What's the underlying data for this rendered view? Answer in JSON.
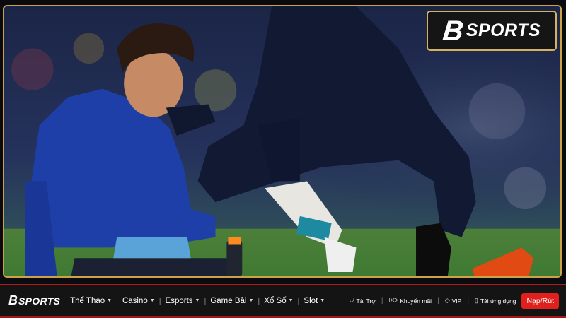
{
  "brand": {
    "mark": "B",
    "name": "SPORTS"
  },
  "nav": {
    "items": [
      {
        "label": "Thể Thao"
      },
      {
        "label": "Casino"
      },
      {
        "label": "Esports"
      },
      {
        "label": "Game Bài"
      },
      {
        "label": "Xổ Số"
      },
      {
        "label": "Slot"
      }
    ],
    "utilities": [
      {
        "label": "Tài Trợ",
        "icon": "shield-icon"
      },
      {
        "label": "Khuyến mãi",
        "icon": "tag-icon"
      },
      {
        "label": "VIP",
        "icon": "diamond-icon"
      },
      {
        "label": "Tải ứng dụng",
        "icon": "phone-icon"
      }
    ],
    "deposit_label": "Nạp/Rút"
  },
  "colors": {
    "accent": "#e0201d",
    "gold": "#d6b25e",
    "navbar_bg": "#141414"
  }
}
